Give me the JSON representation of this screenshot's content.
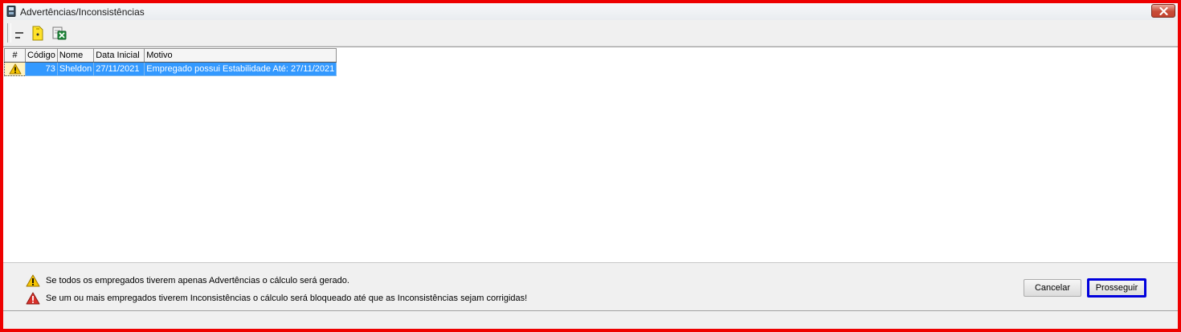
{
  "window": {
    "title": "Advertências/Inconsistências"
  },
  "toolbar": {
    "buttons": [
      {
        "icon": "minus-icon"
      },
      {
        "icon": "yellow-tag-icon"
      },
      {
        "icon": "excel-export-icon"
      }
    ]
  },
  "grid": {
    "columns": [
      "#",
      "Código",
      "Nome",
      "Data Inicial",
      "Motivo"
    ],
    "rows": [
      {
        "status_icon": "warning-icon",
        "codigo": "73",
        "nome": "Sheldon",
        "data_inicial": "27/11/2021",
        "motivo": "Empregado possui Estabilidade Até: 27/11/2021"
      }
    ]
  },
  "legend": {
    "warning_text": "Se todos os empregados tiverem apenas Advertências o cálculo será gerado.",
    "error_text": "Se um ou mais empregados tiverem Inconsistências o cálculo será bloqueado até que as Inconsistências sejam corrigidas!"
  },
  "actions": {
    "cancel_label": "Cancelar",
    "proceed_label": "Prosseguir"
  },
  "colors": {
    "selection": "#3399ff",
    "window_highlight_border": "#ee0000",
    "default_button_border": "#0000dd",
    "warning": "#f5c400",
    "error": "#d9302a"
  }
}
